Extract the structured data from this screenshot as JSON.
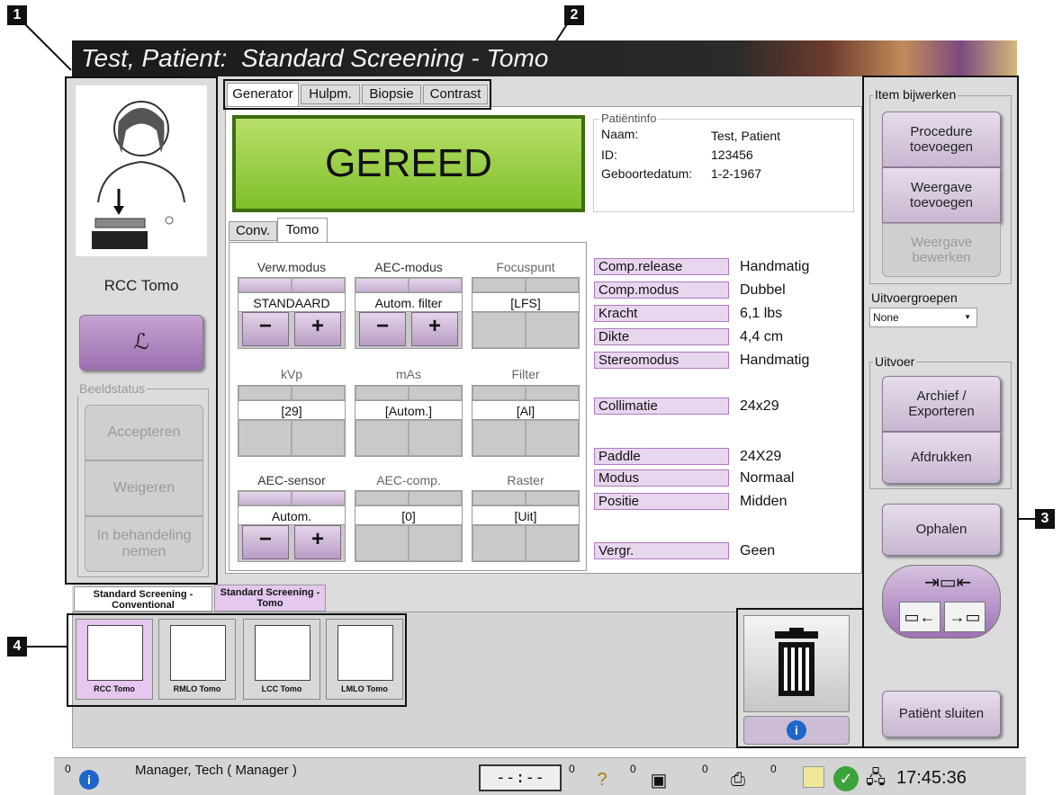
{
  "window_title": "Test, Patient:  Standard Screening - Tomo",
  "callouts": [
    "1",
    "2",
    "3",
    "4"
  ],
  "left": {
    "view_name": "RCC Tomo",
    "image_status_legend": "Beeldstatus",
    "accept": "Accepteren",
    "reject": "Weigeren",
    "pending": "In behandeling nemen"
  },
  "tabs": [
    "Generator",
    "Hulpm.",
    "Biopsie",
    "Contrast"
  ],
  "ready": "GEREED",
  "patient": {
    "legend": "Patiëntinfo",
    "name_label": "Naam:",
    "name": "Test, Patient",
    "id_label": "ID:",
    "id": "123456",
    "dob_label": "Geboortedatum:",
    "dob": "1-2-1967"
  },
  "subtabs": [
    "Conv.",
    "Tomo"
  ],
  "controls": {
    "verw_label": "Verw.modus",
    "verw_value": "STANDAARD",
    "aec_label": "AEC-modus",
    "aec_value": "Autom. filter",
    "focus_label": "Focuspunt",
    "focus_value": "[LFS]",
    "kvp_label": "kVp",
    "kvp_value": "[29]",
    "mas_label": "mAs",
    "mas_value": "[Autom.]",
    "filter_label": "Filter",
    "filter_value": "[Al]",
    "aecs_label": "AEC-sensor",
    "aecs_value": "Autom.",
    "aecc_label": "AEC-comp.",
    "aecc_value": "[0]",
    "raster_label": "Raster",
    "raster_value": "[Uit]",
    "minus": "−",
    "plus": "+"
  },
  "params": [
    {
      "label": "Comp.release",
      "value": "Handmatig"
    },
    {
      "label": "Comp.modus",
      "value": "Dubbel"
    },
    {
      "label": "Kracht",
      "value": "6,1 lbs"
    },
    {
      "label": "Dikte",
      "value": "4,4 cm"
    },
    {
      "label": "Stereomodus",
      "value": "Handmatig"
    },
    {
      "label": "Collimatie",
      "value": "24x29"
    },
    {
      "label": "Paddle",
      "value": "24X29"
    },
    {
      "label": "Modus",
      "value": "Normaal"
    },
    {
      "label": "Positie",
      "value": "Midden"
    },
    {
      "label": "Vergr.",
      "value": "Geen"
    }
  ],
  "right": {
    "update_legend": "Item bijwerken",
    "add_procedure": "Procedure toevoegen",
    "add_view": "Weergave toevoegen",
    "edit_view": "Weergave bewerken",
    "output_groups_legend": "Uitvoergroepen",
    "output_group_value": "None",
    "output_legend": "Uitvoer",
    "archive": "Archief / Exporteren",
    "print": "Afdrukken",
    "retrieve": "Ophalen",
    "close_patient": "Patiënt sluiten"
  },
  "procedure_tabs": [
    "Standard Screening - Conventional",
    "Standard Screening - Tomo"
  ],
  "thumbs": [
    "RCC Tomo",
    "RMLO Tomo",
    "LCC Tomo",
    "LMLO Tomo"
  ],
  "status": {
    "count0": "0",
    "user": "Manager, Tech ( Manager )",
    "timer": "--:--",
    "c1": "0",
    "c2": "0",
    "c3": "0",
    "c4": "0",
    "time": "17:45:36"
  }
}
